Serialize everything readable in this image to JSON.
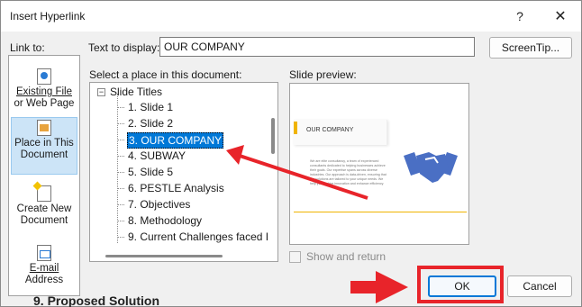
{
  "dialog": {
    "title": "Insert Hyperlink",
    "help_label": "?",
    "close_label": "✕"
  },
  "link_to": {
    "label": "Link to:",
    "items": [
      {
        "label_line1": "Existing File",
        "label_line2": "or Web Page",
        "icon": "web-page-icon"
      },
      {
        "label_line1": "Place in This",
        "label_line2": "Document",
        "icon": "place-in-document-icon",
        "selected": true
      },
      {
        "label_line1": "Create New",
        "label_line2": "Document",
        "icon": "new-document-icon"
      },
      {
        "label_line1": "E-mail",
        "label_line2": "Address",
        "icon": "email-icon"
      }
    ]
  },
  "text_to_display": {
    "label": "Text to display:",
    "value": "OUR COMPANY"
  },
  "screentip_label": "ScreenTip...",
  "place_list": {
    "label": "Select a place in this document:",
    "root": "Slide Titles",
    "items": [
      "1. Slide 1",
      "2. Slide 2",
      "3. OUR COMPANY",
      "4. SUBWAY",
      "5. Slide 5",
      "6. PESTLE Analysis",
      "7. Objectives",
      "8. Methodology",
      "9. Current Challenges faced I"
    ],
    "selected_index": 2
  },
  "preview": {
    "label": "Slide preview:",
    "slide_title": "OUR COMPANY",
    "slide_body": "We are elite consultancy, a team of experienced consultants dedicated to helping businesses achieve their goals. Our expertise spans across diverse industries. Our approach is data-driven, ensuring that our solutions are tailored to your unique needs. We help you to drive innovation and enhance efficiency."
  },
  "show_and_return_label": "Show and return",
  "ok_label": "OK",
  "cancel_label": "Cancel",
  "background_text": "9. Proposed Solution",
  "colors": {
    "annotation_red": "#e8242a",
    "selection_blue": "#0078d7",
    "handshake_blue": "#4a6fc4",
    "slide_accent": "#f0b400"
  }
}
